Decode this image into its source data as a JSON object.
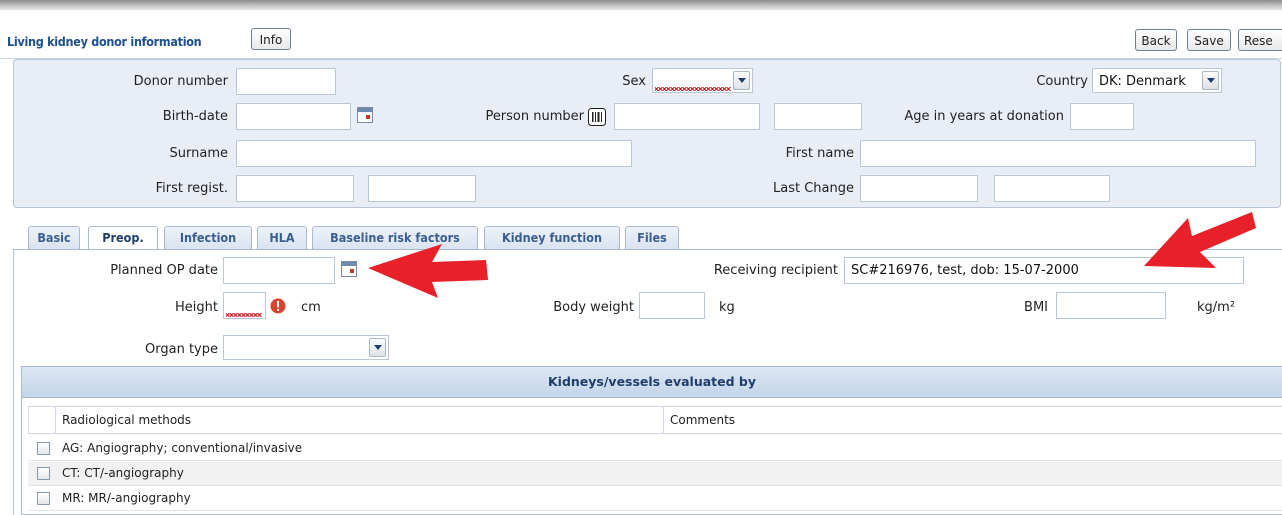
{
  "header": {
    "title": "Living kidney donor information",
    "info_label": "Info",
    "back_label": "Back",
    "save_label": "Save",
    "reset_label": "Rese"
  },
  "donor": {
    "donor_number_label": "Donor number",
    "donor_number": "",
    "sex_label": "Sex",
    "sex_value": "",
    "country_label": "Country",
    "country_value": "DK: Denmark",
    "birth_date_label": "Birth-date",
    "birth_date": "",
    "person_number_label": "Person number",
    "person_number": "",
    "person_number_extra": "",
    "age_label": "Age in years at donation",
    "age_value": "",
    "surname_label": "Surname",
    "surname": "",
    "first_name_label": "First name",
    "first_name": "",
    "first_regist_label": "First regist.",
    "first_regist_1": "",
    "first_regist_2": "",
    "last_change_label": "Last Change",
    "last_change_1": "",
    "last_change_2": ""
  },
  "tabs": [
    {
      "label": "Basic"
    },
    {
      "label": "Preop."
    },
    {
      "label": "Infection"
    },
    {
      "label": "HLA"
    },
    {
      "label": "Baseline risk factors"
    },
    {
      "label": "Kidney function"
    },
    {
      "label": "Files"
    }
  ],
  "active_tab": "Preop.",
  "preop": {
    "planned_op_label": "Planned OP date",
    "planned_op_value": "",
    "recipient_label": "Receiving recipient",
    "recipient_value": "SC#216976, test, dob: 15-07-2000",
    "height_label": "Height",
    "height_value": "",
    "height_unit": "cm",
    "weight_label": "Body weight",
    "weight_value": "",
    "weight_unit": "kg",
    "bmi_label": "BMI",
    "bmi_value": "",
    "bmi_unit": "kg/m²",
    "organ_label": "Organ type",
    "organ_value": ""
  },
  "grid": {
    "title": "Kidneys/vessels evaluated by",
    "col_methods": "Radiological methods",
    "col_comments": "Comments",
    "rows": [
      {
        "label": "AG: Angiography; conventional/invasive",
        "checked": false
      },
      {
        "label": "CT: CT/-angiography",
        "checked": false
      },
      {
        "label": "MR: MR/-angiography",
        "checked": false
      }
    ]
  },
  "colors": {
    "accent": "#1e4f8f",
    "panel_bg": "#e9eef6",
    "annotation_arrow": "#e8202a",
    "error_icon": "#d9432f"
  }
}
